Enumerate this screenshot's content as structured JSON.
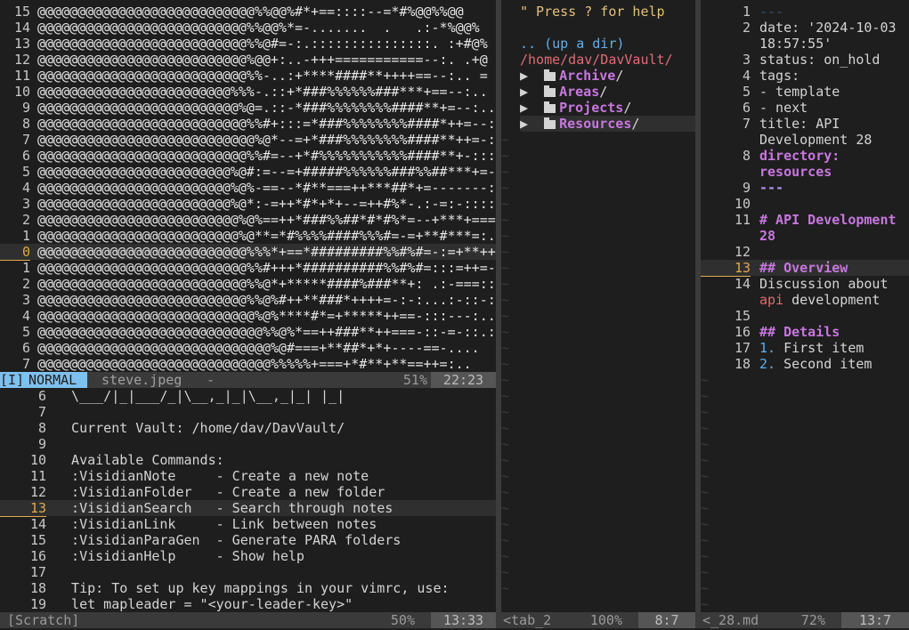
{
  "image_pane": {
    "lines": [
      {
        "n": "15",
        "t": "@@@@@@@@@@@@@@@@@@@@@@@@@@@%%@@%#*+==::::--=*#%@@%%@@"
      },
      {
        "n": "14",
        "t": "@@@@@@@@@@@@@@@@@@@@@@@@@@%%@@%*=-.......  .   .:-*%@@%"
      },
      {
        "n": "13",
        "t": "@@@@@@@@@@@@@@@@@@@@@@@@@@%%@#=-:.:::::::::::::::. :+#@%"
      },
      {
        "n": "12",
        "t": "@@@@@@@@@@@@@@@@@@@@@@@@@@%@@+:..-+++===========--:. .+@"
      },
      {
        "n": "11",
        "t": "@@@@@@@@@@@@@@@@@@@@@@@@@@%%-..:+****####**++++==--:.. ="
      },
      {
        "n": "10",
        "t": "@@@@@@@@@@@@@@@@@@@@@@@@%%%-.::+*###%%%%%%###***+==--:.."
      },
      {
        "n": "9",
        "t": "@@@@@@@@@@@@@@@@@@@@@@@@@%@=.::-*###%%%%%%%%####**+=--:.."
      },
      {
        "n": "8",
        "t": "@@@@@@@@@@@@@@@@@@@@@@@@@@%%#+:::=*###%%%%%%%%####*++=--:."
      },
      {
        "n": "7",
        "t": "@@@@@@@@@@@@@@@@@@@@@@@@@@@%@*--=+*###%%%%%%%%####**++=-::"
      },
      {
        "n": "6",
        "t": "@@@@@@@@@@@@@@@@@@@@@@@@@@%%#=--+*#%%%%%%%%%%%####**+-:::"
      },
      {
        "n": "5",
        "t": "@@@@@@@@@@@@@@@@@@@@@@@@%@#:=--=+#####%%%%%%###%%##***+=-:::"
      },
      {
        "n": "4",
        "t": "@@@@@@@@@@@@@@@@@@@@@@@@%@%-==--*#**===++***##*+=-------::."
      },
      {
        "n": "3",
        "t": "@@@@@@@@@@@@@@@@@@@@@@@@%@*:-=++*#*+*+--=++#%*-.:-=:-::::.."
      },
      {
        "n": "2",
        "t": "@@@@@@@@@@@@@@@@@@@@@@@@@%@%==++*###%%##*#*#%*=--+***+===-::"
      },
      {
        "n": "1",
        "t": "@@@@@@@@@@@@@@@@@@@@@@@@@%@**=*#%%%%####%%%#=-=+**#***=:."
      },
      {
        "n": "0",
        "t": "@@@@@@@@@@@@@@@@@@@@@@@@@@%%%*+==*#########%%#%#=-:=+**++=:."
      },
      {
        "n": "1",
        "t": "@@@@@@@@@@@@@@@@@@@@@@@@@@%%#+++*##########%%#%#=:::=++=-::::"
      },
      {
        "n": "2",
        "t": "@@@@@@@@@@@@@@@@@@@@@@@@@@%%@*+*****####%###**+: .:-===::::"
      },
      {
        "n": "3",
        "t": "@@@@@@@@@@@@@@@@@@@@@@@@@@%%@%#++**###*++++=-:-:...:-::-::.."
      },
      {
        "n": "4",
        "t": "@@@@@@@@@@@@@@@@@@@@@@@@@@@%@%****#*=+*****++==-:::---:...."
      },
      {
        "n": "5",
        "t": "@@@@@@@@@@@@@@@@@@@@@@@@@@@@%%@%*==++###**++===-::-=-::.:..+"
      },
      {
        "n": "6",
        "t": "@@@@@@@@@@@@@@@@@@@@@@@@@@@@@%@#===+**##*+*+----==-...."
      },
      {
        "n": "7",
        "t": "@@@@@@@@@@@@@@@@@@@@@@@@@@@@@%%%%%+===+*#**+**==++=:.."
      }
    ],
    "cursor_line": 15,
    "status": {
      "mode_prefix": "[I]",
      "mode": "NORMAL",
      "file": "steve.jpeg",
      "mod": "-",
      "percent": "51%",
      "pos": "22:23"
    }
  },
  "scratch_pane": {
    "lines": [
      {
        "n": "6",
        "t": "  \\___/|_|___/_|\\__,_|_|\\__,_|_| |_|"
      },
      {
        "n": "7",
        "t": ""
      },
      {
        "n": "8",
        "t": "  Current Vault: /home/dav/DavVault/"
      },
      {
        "n": "9",
        "t": ""
      },
      {
        "n": "10",
        "t": "  Available Commands:"
      },
      {
        "n": "11",
        "t": "  :VisidianNote     - Create a new note"
      },
      {
        "n": "12",
        "t": "  :VisidianFolder   - Create a new folder"
      },
      {
        "n": "13",
        "t": "  :VisidianSearch   - Search through notes"
      },
      {
        "n": "14",
        "t": "  :VisidianLink     - Link between notes"
      },
      {
        "n": "15",
        "t": "  :VisidianParaGen  - Generate PARA folders"
      },
      {
        "n": "16",
        "t": "  :VisidianHelp     - Show help"
      },
      {
        "n": "17",
        "t": ""
      },
      {
        "n": "18",
        "t": "  Tip: To set up key mappings in your vimrc, use:"
      },
      {
        "n": "19",
        "t": "  let mapleader = \"<your-leader-key>\""
      }
    ],
    "cursor_line": 7,
    "status": {
      "file": "[Scratch]",
      "percent": "50%",
      "pos": "13:33"
    }
  },
  "tree_pane": {
    "help": "\" Press ? for help",
    "up_dir": ".. (up a dir)",
    "path": "/home/dav/DavVault/",
    "folders": [
      {
        "arrow": "▶",
        "name": "Archive",
        "suffix": "/"
      },
      {
        "arrow": "▶",
        "name": "Areas",
        "suffix": "/"
      },
      {
        "arrow": "▶",
        "name": "Projects",
        "suffix": "/"
      },
      {
        "arrow": "▶",
        "name": "Resources",
        "suffix": "/"
      }
    ],
    "status": {
      "file": "<tab_2",
      "percent": "100%",
      "pos": "8:7"
    }
  },
  "note_pane": {
    "rows": [
      {
        "n": "1",
        "parts": [
          {
            "t": "---",
            "c": "#3b4a7a"
          }
        ]
      },
      {
        "n": "2",
        "parts": [
          {
            "t": "date: '2024-10-03",
            "c": ""
          }
        ]
      },
      {
        "n": "",
        "parts": [
          {
            "t": "18:57:55'",
            "c": ""
          }
        ]
      },
      {
        "n": "3",
        "parts": [
          {
            "t": "status: on_hold",
            "c": ""
          }
        ]
      },
      {
        "n": "4",
        "parts": [
          {
            "t": "tags:",
            "c": ""
          }
        ]
      },
      {
        "n": "5",
        "parts": [
          {
            "t": "- template",
            "c": ""
          }
        ]
      },
      {
        "n": "6",
        "parts": [
          {
            "t": "- next",
            "c": ""
          }
        ]
      },
      {
        "n": "7",
        "parts": [
          {
            "t": "title: API",
            "c": ""
          }
        ]
      },
      {
        "n": "",
        "parts": [
          {
            "t": "Development 28",
            "c": ""
          }
        ]
      },
      {
        "n": "8",
        "parts": [
          {
            "t": "directory:",
            "c": "#c678dd",
            "b": true
          }
        ]
      },
      {
        "n": "",
        "parts": [
          {
            "t": "resources",
            "c": "#c678dd",
            "b": true
          }
        ]
      },
      {
        "n": "9",
        "parts": [
          {
            "t": "---",
            "c": "#b794f6",
            "b": true
          }
        ]
      },
      {
        "n": "10",
        "parts": [
          {
            "t": "",
            "c": ""
          }
        ]
      },
      {
        "n": "11",
        "parts": [
          {
            "t": "# API Development",
            "c": "#c678dd",
            "b": true
          }
        ]
      },
      {
        "n": "",
        "parts": [
          {
            "t": "28",
            "c": "#c678dd",
            "b": true
          }
        ]
      },
      {
        "n": "12",
        "parts": [
          {
            "t": "",
            "c": ""
          }
        ]
      },
      {
        "n": "13",
        "parts": [
          {
            "t": "## Overview",
            "c": "#c678dd",
            "b": true
          }
        ]
      },
      {
        "n": "14",
        "parts": [
          {
            "t": "Discussion about",
            "c": ""
          }
        ]
      },
      {
        "n": "",
        "parts": [
          {
            "t": "api",
            "c": "#e06c75"
          },
          {
            "t": " development",
            "c": ""
          }
        ]
      },
      {
        "n": "15",
        "parts": [
          {
            "t": "",
            "c": ""
          }
        ]
      },
      {
        "n": "16",
        "parts": [
          {
            "t": "## Details",
            "c": "#c678dd",
            "b": true
          }
        ]
      },
      {
        "n": "17",
        "parts": [
          {
            "t": "1.",
            "c": "#61afef"
          },
          {
            "t": " First item",
            "c": ""
          }
        ]
      },
      {
        "n": "18",
        "parts": [
          {
            "t": "2.",
            "c": "#61afef"
          },
          {
            "t": " Second item",
            "c": ""
          }
        ]
      }
    ],
    "cursor_row": 16,
    "status": {
      "file": "<_28.md",
      "percent": "72%",
      "pos": "13:7"
    }
  },
  "colors": {
    "accent": "#e0a84e",
    "mode_bg": "#7ec0ee",
    "status_bg": "#3a3a3a"
  }
}
